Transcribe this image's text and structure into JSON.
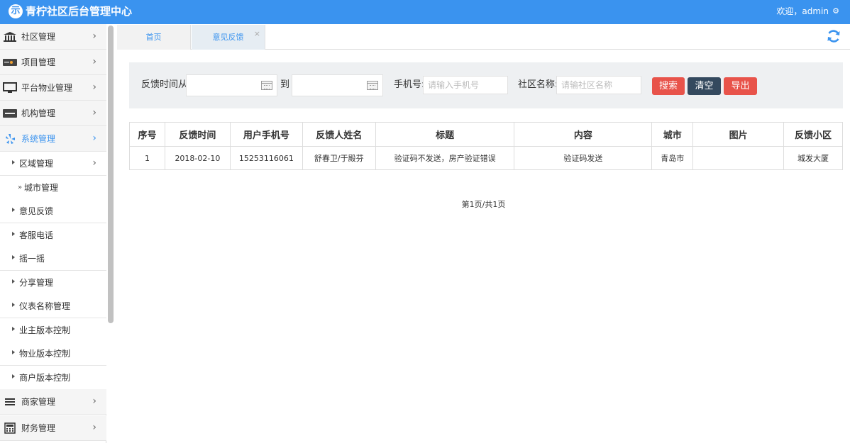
{
  "app": {
    "title": "青柠社区后台管理中心",
    "logo_glyph": "示",
    "welcome": "欢迎，admin",
    "accent_color": "#3a93ef"
  },
  "sidebar": {
    "menus": [
      {
        "label": "社区管理",
        "icon": "bank-icon"
      },
      {
        "label": "项目管理",
        "icon": "discover-card-icon"
      },
      {
        "label": "平台物业管理",
        "icon": "monitor-icon"
      },
      {
        "label": "机构管理",
        "icon": "stripe-icon"
      },
      {
        "label": "系统管理",
        "icon": "yelp-icon"
      }
    ],
    "sub_items": [
      {
        "label": "区域管理"
      },
      {
        "label": "城市管理"
      },
      {
        "label": "意见反馈"
      },
      {
        "label": "客服电话"
      },
      {
        "label": "摇一摇"
      },
      {
        "label": "分享管理"
      },
      {
        "label": "仪表名称管理"
      },
      {
        "label": "业主版本控制"
      },
      {
        "label": "物业版本控制"
      },
      {
        "label": "商户版本控制"
      }
    ],
    "bottom_menus": [
      {
        "label": "商家管理",
        "icon": "bars-icon"
      },
      {
        "label": "财务管理",
        "icon": "calculator-icon"
      }
    ],
    "arrow": "›",
    "double_arrow": "»"
  },
  "tabs": [
    {
      "label": "首页"
    },
    {
      "label": "意见反馈",
      "close": "×"
    }
  ],
  "filters": {
    "time_from_label": "反馈时间从",
    "to_label": "到",
    "phone_label": "手机号:",
    "phone_placeholder": "请输入手机号",
    "community_label": "社区名称:",
    "community_placeholder": "请输社区名称",
    "search_button": "搜索",
    "clear_button": "清空",
    "export_button": "导出"
  },
  "table": {
    "columns": [
      "序号",
      "反馈时间",
      "用户手机号",
      "反馈人姓名",
      "标题",
      "内容",
      "城市",
      "图片",
      "反馈小区"
    ],
    "rows": [
      [
        "1",
        "2018-02-10",
        "15253116061",
        "舒春卫/于殿芬",
        "验证码不发送，房产验证错误",
        "验证码发送",
        "青岛市",
        "",
        "城发大厦"
      ]
    ]
  },
  "pager": {
    "text": "第1页/共1页"
  }
}
